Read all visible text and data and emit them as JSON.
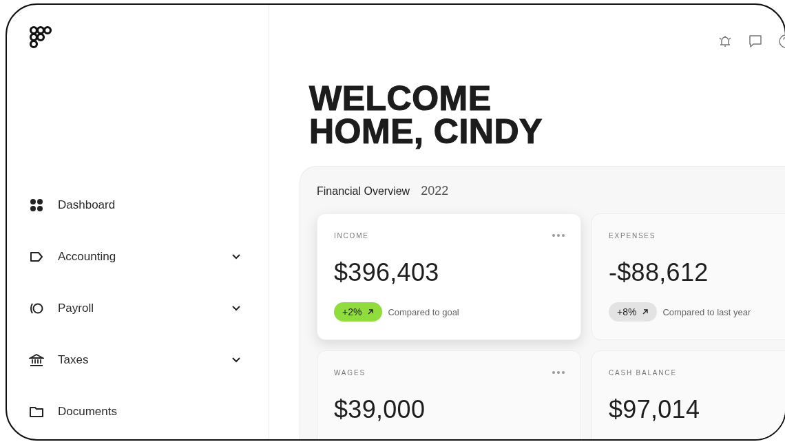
{
  "sidebar": {
    "items": [
      {
        "label": "Dashboard",
        "expandable": false
      },
      {
        "label": "Accounting",
        "expandable": true
      },
      {
        "label": "Payroll",
        "expandable": true
      },
      {
        "label": "Taxes",
        "expandable": true
      },
      {
        "label": "Documents",
        "expandable": false
      }
    ]
  },
  "heading": "WELCOME HOME, CINDY",
  "overview": {
    "title": "Financial Overview",
    "year": "2022",
    "cards": [
      {
        "label": "INCOME",
        "amount": "$396,403",
        "menu": true,
        "selected": true,
        "badge": {
          "text": "+2%",
          "color": "#8fdc3c"
        },
        "comparison": "Compared to goal"
      },
      {
        "label": "EXPENSES",
        "amount": "-$88,612",
        "menu": false,
        "selected": false,
        "badge": {
          "text": "+8%",
          "color": "#e3e3e3"
        },
        "comparison": "Compared to last year"
      },
      {
        "label": "WAGES",
        "amount": "$39,000",
        "menu": true,
        "selected": false
      },
      {
        "label": "CASH BALANCE",
        "amount": "$97,014",
        "menu": false,
        "selected": false
      }
    ]
  }
}
